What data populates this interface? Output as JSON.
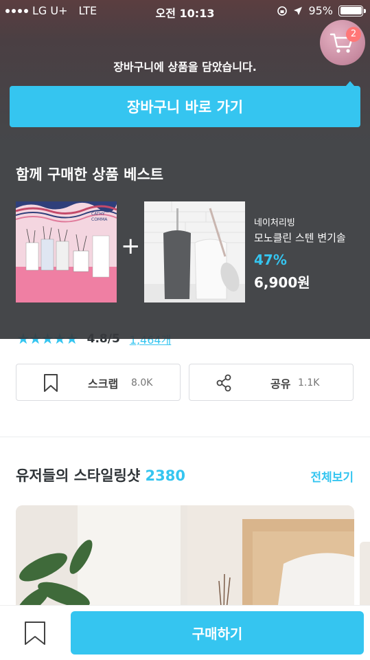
{
  "status_bar": {
    "carrier": "LG U+",
    "network": "LTE",
    "time": "오전 10:13",
    "battery": "95%"
  },
  "cart_popup": {
    "badge_count": "2",
    "message": "장바구니에 상품을 담았습니다.",
    "go_cart_label": "장바구니 바로 가기",
    "best_title": "함께 구매한 상품 베스트",
    "product": {
      "brand": "네이처리빙",
      "name": "모노클린 스텐 변기솔",
      "discount": "47%",
      "price": "6,900원"
    },
    "bundle_image_text": "CATHY COMMA"
  },
  "product_page": {
    "rating_score": "4.8/5",
    "review_link": "1,464개",
    "rating_stars": 4.8,
    "scrap": {
      "label": "스크랩",
      "count": "8.0K"
    },
    "share": {
      "label": "공유",
      "count": "1.1K"
    },
    "styling": {
      "title": "유저들의 스타일링샷",
      "count": "2380",
      "see_all": "전체보기"
    }
  },
  "bottom_bar": {
    "buy_label": "구매하기"
  },
  "colors": {
    "accent": "#35c5f0",
    "badge": "#ff7777"
  }
}
